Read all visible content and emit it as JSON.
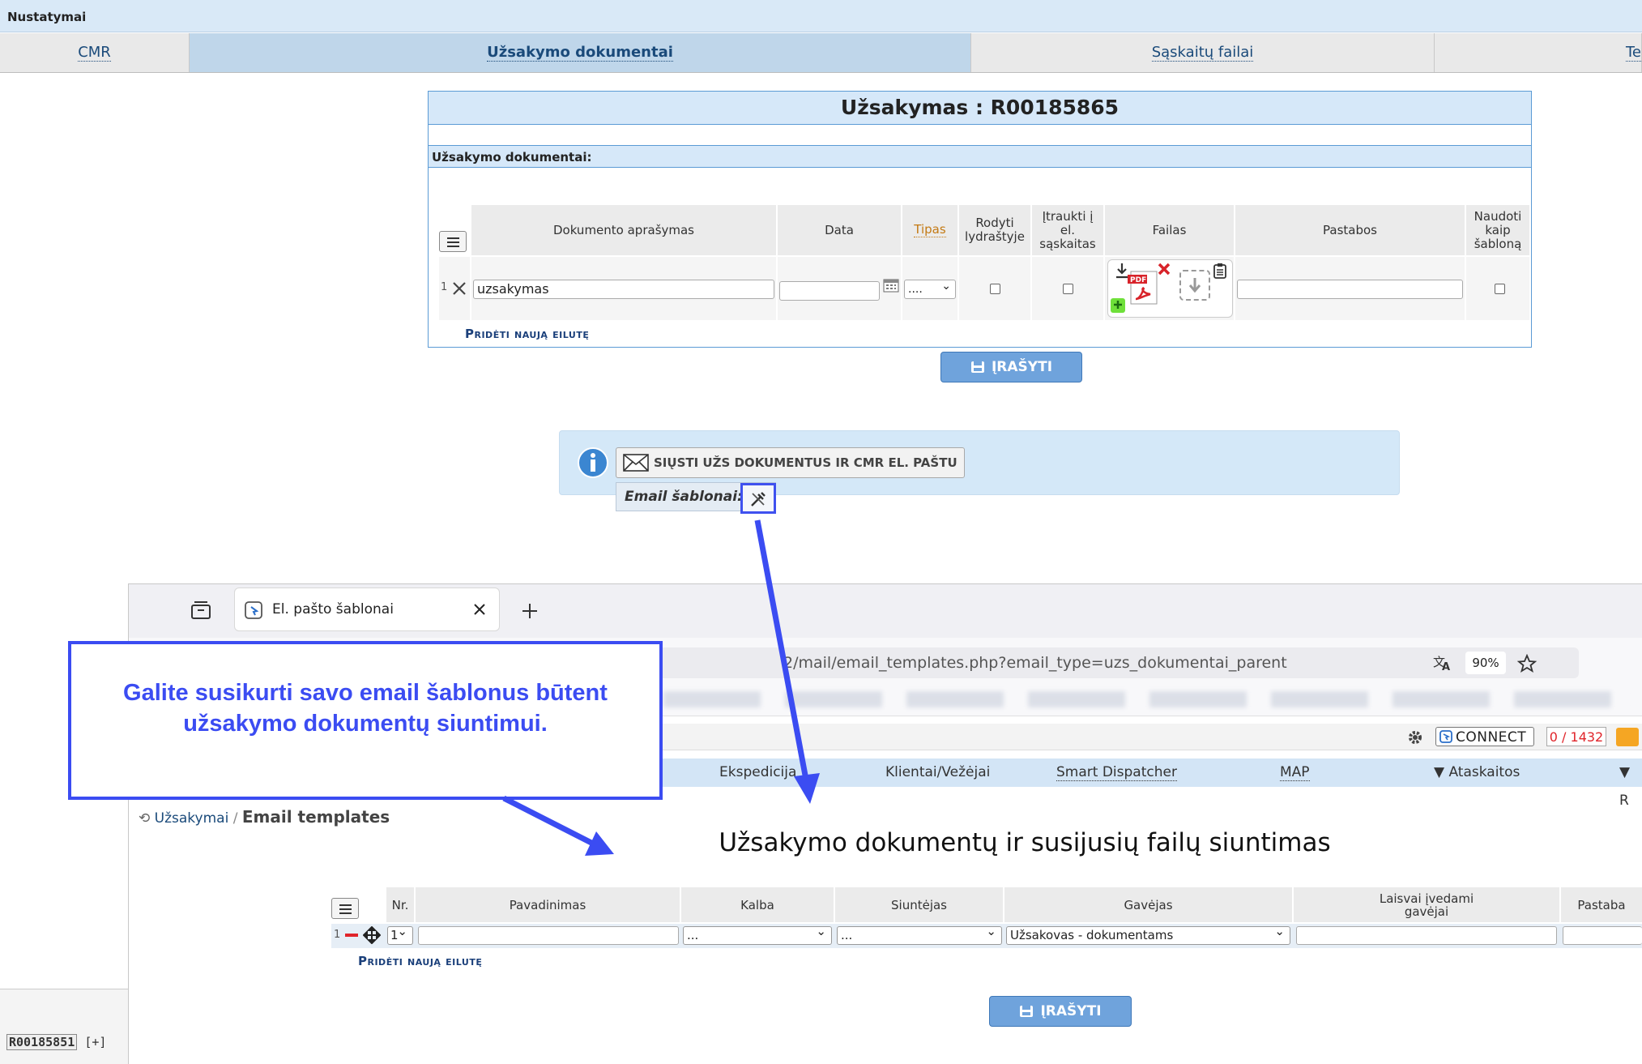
{
  "app": {
    "title": "Nustatymai"
  },
  "top_tabs": [
    {
      "label": "CMR"
    },
    {
      "label": "Užsakymo dokumentai"
    },
    {
      "label": "Sąskaitų failai"
    },
    {
      "label": "Te"
    }
  ],
  "order": {
    "title": "Užsakymas : R00185865",
    "section": "Užsakymo dokumentai:",
    "columns": {
      "description": "Dokumento aprašymas",
      "date": "Data",
      "type": "Tipas",
      "show_cover": [
        "Rodyti",
        "lydraštyje"
      ],
      "include_invoice": [
        "Įtraukti į",
        "el.",
        "sąskaitas"
      ],
      "files": "Failas",
      "notes": "Pastabos",
      "use_template": [
        "Naudoti",
        "kaip",
        "šabloną"
      ]
    },
    "row": {
      "nr": "1",
      "description": "uzsakymas",
      "date": "",
      "type": "....",
      "notes": ""
    },
    "add_row": "Pridėti naują eilutę",
    "save": "ĮRAŠYTI"
  },
  "info": {
    "send_button": "SIŲSTI UŽS DOKUMENTUS IR CMR EL. PAŠTU",
    "templates_label": "Email šablonai:"
  },
  "callout": {
    "line1": "Galite susikurti savo email šablonus būtent",
    "line2": "užsakymo dokumentų siuntimui."
  },
  "browser": {
    "tab_title": "El. pašto šablonai",
    "url": "2/mail/email_templates.php?email_type=uzs_dokumentai_parent",
    "zoom": "90%",
    "connect": "CONNECT",
    "counter": "0 / 1432",
    "nav": [
      "Ekspedicija",
      "Klientai/Vežėjai",
      "Smart Dispatcher",
      "MAP",
      "▼ Ataskaitos",
      "▼ R"
    ],
    "breadcrumb_link": "Užsakymai",
    "breadcrumb_current": "Email templates",
    "page_title": "Užsakymo dokumentų ir susijusių failų siuntimas",
    "columns": {
      "nr": "Nr.",
      "name": "Pavadinimas",
      "language": "Kalba",
      "sender": "Siuntėjas",
      "receiver": "Gavėjas",
      "free_receivers": [
        "Laisvai įvedami",
        "gavėjai"
      ],
      "note": "Pastaba"
    },
    "row": {
      "index": "1",
      "nr": "1",
      "name": "",
      "language": "...",
      "sender": "...",
      "receiver": "Užsakovas - dokumentams"
    },
    "add_row": "Pridėti naują eilutę",
    "save": "ĮRAŠYTI"
  },
  "status": {
    "order_ref": "R00185851",
    "plus": "[+]"
  },
  "colors": {
    "accent": "#3b4cf2",
    "header_blue": "#d6e8f9",
    "button_blue": "#6fa3dc"
  }
}
